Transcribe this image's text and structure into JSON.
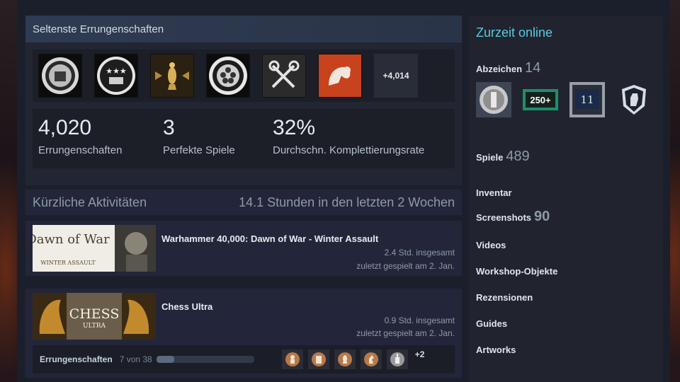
{
  "rare_achievements": {
    "title": "Seltenste Errungenschaften",
    "icons": [
      "seal-icon",
      "stars-icon",
      "trophy-icon",
      "film-reel-icon",
      "keys-icon",
      "muscle-icon"
    ],
    "more_label": "+4,014"
  },
  "stats": [
    {
      "value": "4,020",
      "label": "Errungenschaften"
    },
    {
      "value": "3",
      "label": "Perfekte Spiele"
    },
    {
      "value": "32%",
      "label": "Durchschn. Komplettierungsrate"
    }
  ],
  "recent": {
    "title": "Kürzliche Aktivitäten",
    "summary": "14.1 Stunden in den letzten 2 Wochen",
    "games": [
      {
        "name": "Warhammer 40,000: Dawn of War - Winter Assault",
        "hours": "2.4 Std. insgesamt",
        "last_played": "zuletzt gespielt am 2. Jan.",
        "capsule_text": "Dawn of War",
        "capsule_sub": "WINTER ASSAULT"
      },
      {
        "name": "Chess Ultra",
        "hours": "0.9 Std. insgesamt",
        "last_played": "zuletzt gespielt am 2. Jan.",
        "capsule_text": "CHESS",
        "capsule_sub": "ULTRA",
        "achievements": {
          "label": "Errungenschaften",
          "count": "7 von 38",
          "progress": 0.184,
          "more": "+2"
        }
      }
    ]
  },
  "sidebar": {
    "status": "Zurzeit online",
    "badges": {
      "label": "Abzeichen",
      "count": "14",
      "xp_badge": "250+",
      "level_badge": "11"
    },
    "games": {
      "label": "Spiele",
      "count": "489"
    },
    "inventory": "Inventar",
    "screenshots": {
      "label": "Screenshots",
      "count": "90"
    },
    "videos": "Videos",
    "workshop": "Workshop-Objekte",
    "reviews": "Rezensionen",
    "guides": "Guides",
    "artworks": "Artworks"
  },
  "colors": {
    "accent": "#57cbde",
    "panel": "#222532"
  }
}
